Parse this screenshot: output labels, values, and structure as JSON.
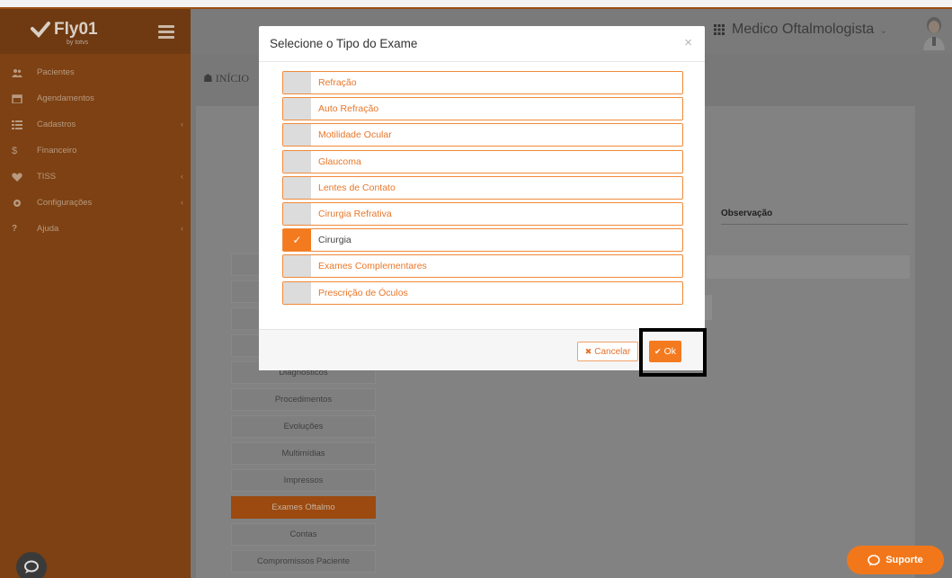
{
  "brand": {
    "name": "Fly01",
    "sub": "by totvs"
  },
  "sidebar": {
    "items": [
      {
        "label": "Pacientes",
        "icon": "users-icon",
        "caret": false
      },
      {
        "label": "Agendamentos",
        "icon": "calendar-icon",
        "caret": false
      },
      {
        "label": "Cadastros",
        "icon": "list-icon",
        "caret": true
      },
      {
        "label": "Financeiro",
        "icon": "dollar-icon",
        "caret": false
      },
      {
        "label": "TISS",
        "icon": "heartbeat-icon",
        "caret": true
      },
      {
        "label": "Configurações",
        "icon": "gear-icon",
        "caret": true
      },
      {
        "label": "Ajuda",
        "icon": "question-icon",
        "caret": true
      }
    ]
  },
  "header": {
    "user": "Medico Oftalmologista"
  },
  "breadcrumb": "INÍCIO",
  "table": {
    "obs_header": "Observação"
  },
  "tabs": [
    {
      "label": "Diagnósticos",
      "active": false
    },
    {
      "label": "Procedimentos",
      "active": false
    },
    {
      "label": "Evoluções",
      "active": false
    },
    {
      "label": "Multimídias",
      "active": false
    },
    {
      "label": "Impressos",
      "active": false
    },
    {
      "label": "Exames Oftalmo",
      "active": true
    },
    {
      "label": "Contas",
      "active": false
    },
    {
      "label": "Compromissos Paciente",
      "active": false
    }
  ],
  "support_label": "Suporte",
  "modal": {
    "title": "Selecione o Tipo do Exame",
    "close": "×",
    "options": [
      {
        "label": "Refração",
        "checked": false
      },
      {
        "label": "Auto Refração",
        "checked": false
      },
      {
        "label": "Motilidade Ocular",
        "checked": false
      },
      {
        "label": "Glaucoma",
        "checked": false
      },
      {
        "label": "Lentes de Contato",
        "checked": false
      },
      {
        "label": "Cirurgia Refrativa",
        "checked": false
      },
      {
        "label": "Cirurgia",
        "checked": true
      },
      {
        "label": "Exames Complementares",
        "checked": false
      },
      {
        "label": "Prescrição de Óculos",
        "checked": false
      }
    ],
    "cancel_label": "Cancelar",
    "ok_label": "Ok"
  },
  "colors": {
    "accent": "#f47a1f",
    "sidebar": "#7d4113",
    "option_text": "#e8772a"
  }
}
